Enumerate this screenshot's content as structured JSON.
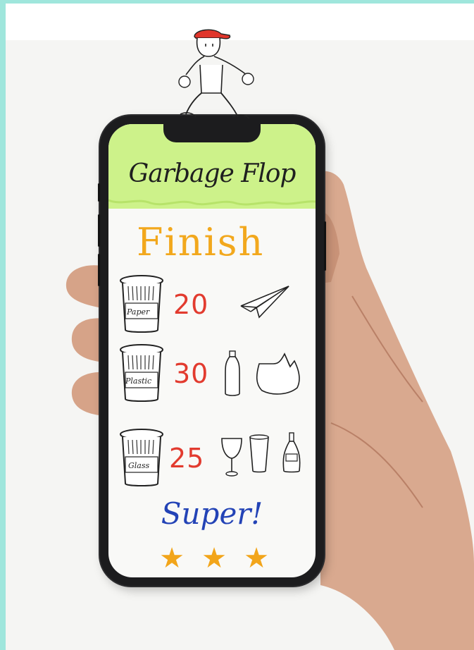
{
  "app": {
    "title": "Garbage Flop",
    "heading": "Finish"
  },
  "results": [
    {
      "bin_label": "Paper",
      "count": "20",
      "items": [
        "paper-plane-icon"
      ]
    },
    {
      "bin_label": "Plastic",
      "count": "30",
      "items": [
        "plastic-bottle-icon",
        "plastic-bag-icon"
      ]
    },
    {
      "bin_label": "Glass",
      "count": "25",
      "items": [
        "wine-glass-icon",
        "drinking-glass-icon",
        "glass-bottle-icon"
      ]
    }
  ],
  "rating": {
    "message": "Super!",
    "stars": 3,
    "star_symbol": "★"
  },
  "colors": {
    "header": "#cdf28a",
    "heading": "#f2a81d",
    "count": "#e23b2f",
    "message": "#2343b6",
    "star": "#f2a51a",
    "mascot_cap": "#e0352b"
  }
}
